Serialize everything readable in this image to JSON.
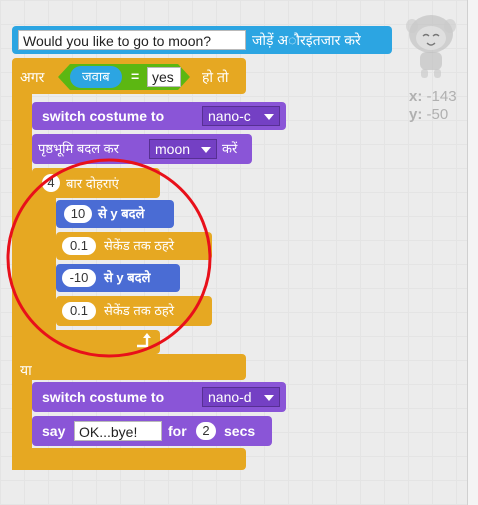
{
  "ask_block": {
    "question": "Would you like to go to moon?",
    "suffix": "जोड़ें अ◌ौरइंतजार करे"
  },
  "if_block": {
    "if_label": "अगर",
    "sensing_label": "जवाब",
    "operator": "=",
    "compare_value": "yes",
    "then_label": "हो तो",
    "else_label": "या"
  },
  "switch_costume_1": {
    "label": "switch costume to",
    "value": "nano-c"
  },
  "switch_backdrop": {
    "label": "पृष्ठभूमि बदल कर",
    "value": "moon",
    "suffix": "करें"
  },
  "repeat_block": {
    "count": "4",
    "label": "बार दोहराएं",
    "loop_icon": "loop-arrow-icon"
  },
  "change_y_1": {
    "value": "10",
    "label": "से y बदले"
  },
  "wait_1": {
    "value": "0.1",
    "label": "सेकेंड तक ठहरे"
  },
  "change_y_2": {
    "value": "-10",
    "label": "से y बदले"
  },
  "wait_2": {
    "value": "0.1",
    "label": "सेकेंड तक ठहरे"
  },
  "switch_costume_2": {
    "label": "switch costume to",
    "value": "nano-d"
  },
  "say_block": {
    "label_say": "say",
    "message": "OK...bye!",
    "label_for": "for",
    "seconds": "2",
    "label_secs": "secs"
  },
  "sprite_info": {
    "x_label": "x:",
    "x_value": "-143",
    "y_label": "y:",
    "y_value": "-50",
    "sprite_name_icon": "nano-sprite-icon"
  },
  "colors": {
    "control": "#e6a822",
    "looks": "#8a55d7",
    "motion": "#4a6cd4",
    "sensing": "#2ca5e2",
    "operators": "#5cb712",
    "highlight": "#e8101a"
  }
}
